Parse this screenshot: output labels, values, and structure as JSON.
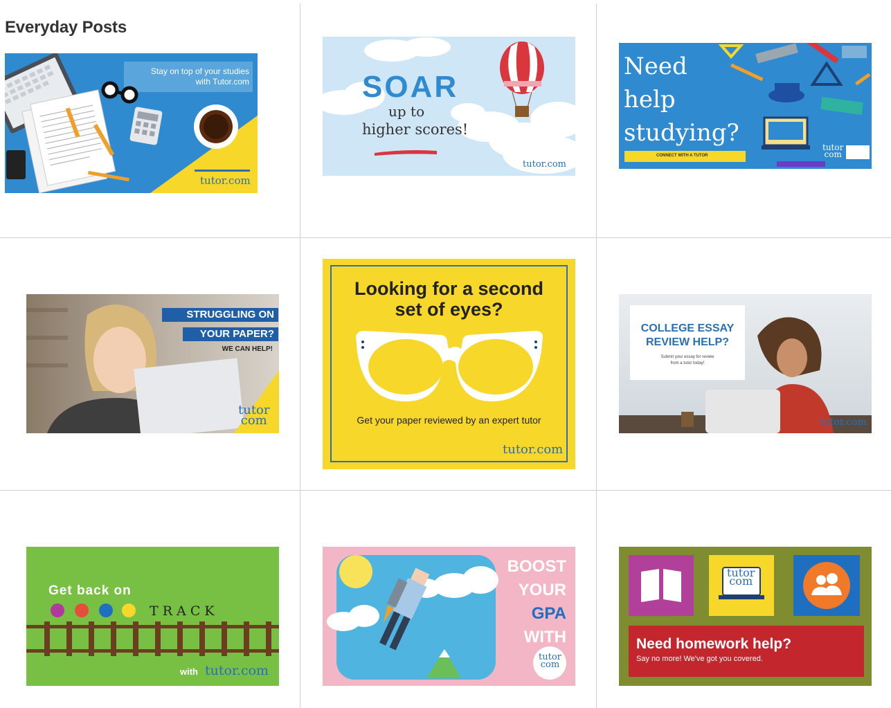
{
  "section": {
    "title": "Everyday Posts"
  },
  "brand": {
    "name": "tutor.com",
    "stacked_top": "tutor",
    "stacked_bottom": "com"
  },
  "posts": [
    {
      "lines": [
        "Stay on top of your studies",
        "with Tutor.com"
      ]
    },
    {
      "headline": "SOAR",
      "lines": [
        "up to",
        "higher scores!"
      ]
    },
    {
      "lines": [
        "Need",
        "help",
        "studying?"
      ],
      "cta": "CONNECT WITH A TUTOR"
    },
    {
      "lines": [
        "STRUGGLING ON",
        "YOUR PAPER?"
      ],
      "sub": "WE CAN HELP!"
    },
    {
      "lines": [
        "Looking for a second",
        "set of eyes?"
      ],
      "sub": "Get your paper reviewed by an expert tutor"
    },
    {
      "lines": [
        "COLLEGE ESSAY",
        "REVIEW HELP?"
      ],
      "sub_lines": [
        "Submit your essay for review",
        "from a tutor today!"
      ]
    },
    {
      "lines": [
        "Get back on"
      ],
      "word": "T  R  A  C  K",
      "with": "with"
    },
    {
      "lines": [
        "BOOST",
        "YOUR",
        "GPA",
        "WITH"
      ]
    },
    {
      "title": "Need homework help?",
      "sub": "Say no more! We've got you covered."
    }
  ],
  "colors": {
    "blue": "#2f8ad0",
    "yellow": "#f7d72a",
    "green": "#78c043",
    "pink": "#f2b6c6",
    "olive": "#7f8c2f",
    "red": "#b5252b",
    "navy": "#1f3f73",
    "brand_blue": "#2a6fb3"
  }
}
